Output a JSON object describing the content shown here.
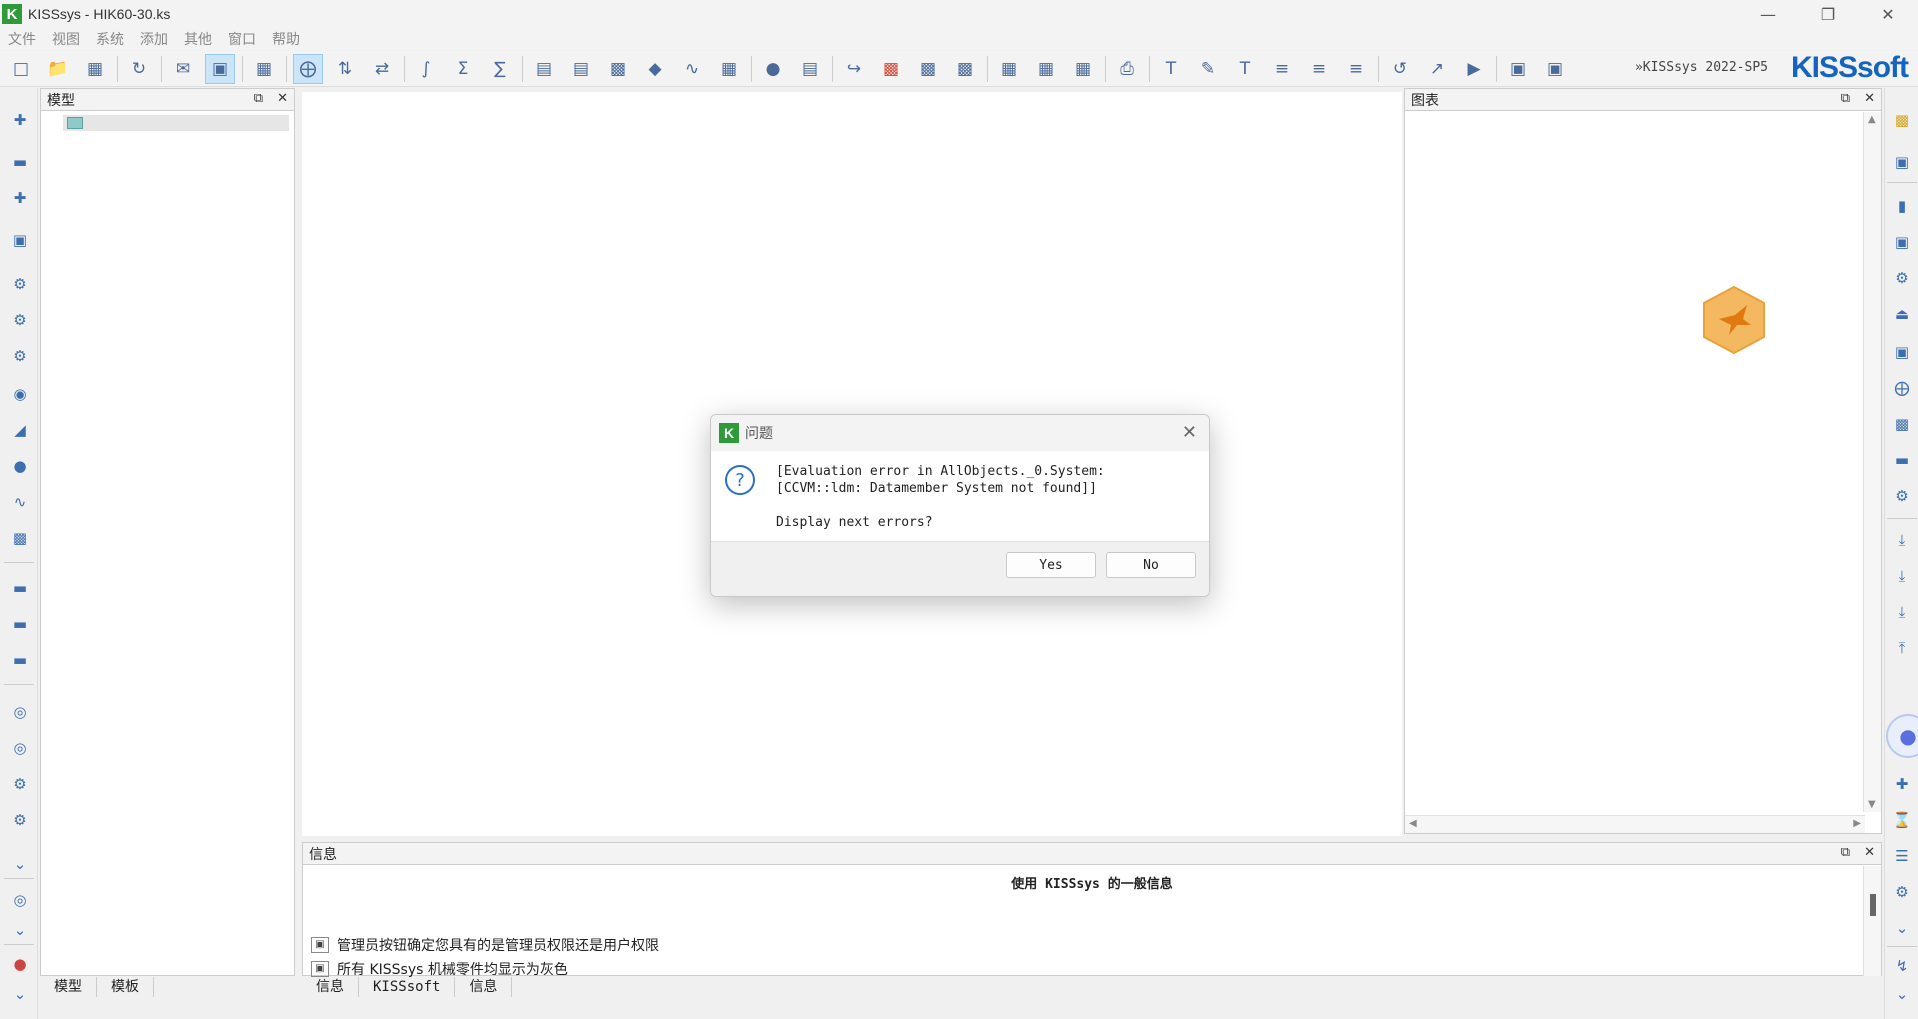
{
  "window": {
    "app_icon_letter": "K",
    "title": "KISSsys - HIK60-30.ks",
    "controls": {
      "minimize": "—",
      "maximize": "❐",
      "close": "✕"
    }
  },
  "menu": [
    "文件",
    "视图",
    "系统",
    "添加",
    "其他",
    "窗口",
    "帮助"
  ],
  "toolbar": {
    "version": "»KISSsys 2022-SP5",
    "brand": "KISSsoft"
  },
  "model_panel": {
    "title": "模型",
    "tabs": [
      "模型",
      "模板"
    ]
  },
  "chart_panel": {
    "title": "图表"
  },
  "info_panel": {
    "title": "信息",
    "heading": "使用 KISSsys 的一般信息",
    "lines": [
      "管理员按钮确定您具有的是管理员权限还是用户权限",
      "所有 KISSsys 机械零件均显示为灰色"
    ],
    "tabs": [
      "信息",
      "KISSsoft",
      "信息"
    ]
  },
  "dialog": {
    "icon_letter": "K",
    "title": "问题",
    "close": "✕",
    "question_glyph": "?",
    "message": "[Evaluation error in AllObjects._0.System:\n[CCVM::ldm: Datamember System not found]]",
    "prompt": "Display next errors?",
    "yes_label": "Yes",
    "no_label": "No"
  }
}
